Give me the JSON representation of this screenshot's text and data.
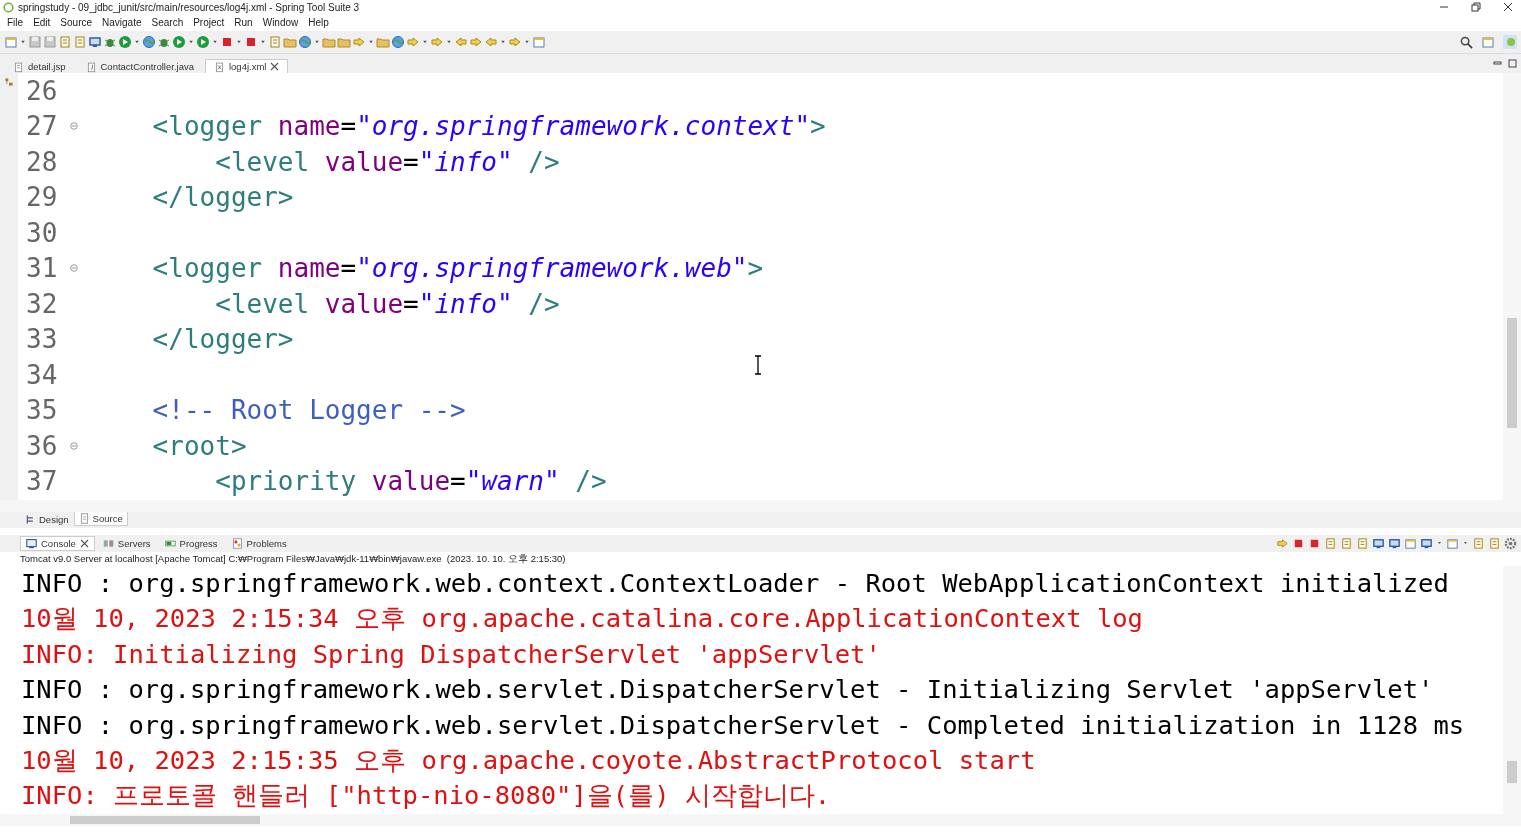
{
  "window": {
    "title": "springstudy - 09_jdbc_junit/src/main/resources/log4j.xml - Spring Tool Suite 3"
  },
  "menu": [
    "File",
    "Edit",
    "Source",
    "Navigate",
    "Search",
    "Project",
    "Run",
    "Window",
    "Help"
  ],
  "editor_tabs": [
    {
      "label": "detail.jsp",
      "kind": "jsp",
      "selected": false
    },
    {
      "label": "ContactController.java",
      "kind": "java",
      "selected": false
    },
    {
      "label": "log4j.xml",
      "kind": "xml",
      "selected": true
    }
  ],
  "code_lines": [
    {
      "number": "26",
      "foldable": false
    },
    {
      "number": "27",
      "foldable": true,
      "tokens": [
        {
          "kind": "tag",
          "text": "    <logger"
        },
        {
          "kind": "attr",
          "text": " name"
        },
        {
          "kind": "punct",
          "text": "="
        },
        {
          "kind": "string",
          "text": "\"org.springframework.context\""
        },
        {
          "kind": "tag",
          "text": ">"
        }
      ]
    },
    {
      "number": "28",
      "foldable": false,
      "tokens": [
        {
          "kind": "tag",
          "text": "        <level"
        },
        {
          "kind": "attr",
          "text": " value"
        },
        {
          "kind": "punct",
          "text": "="
        },
        {
          "kind": "string",
          "text": "\"info\""
        },
        {
          "kind": "tag",
          "text": " />"
        }
      ]
    },
    {
      "number": "29",
      "foldable": false,
      "tokens": [
        {
          "kind": "tag",
          "text": "    </logger>"
        }
      ]
    },
    {
      "number": "30",
      "foldable": false
    },
    {
      "number": "31",
      "foldable": true,
      "tokens": [
        {
          "kind": "tag",
          "text": "    <logger"
        },
        {
          "kind": "attr",
          "text": " name"
        },
        {
          "kind": "punct",
          "text": "="
        },
        {
          "kind": "string",
          "text": "\"org.springframework.web\""
        },
        {
          "kind": "tag",
          "text": ">"
        }
      ]
    },
    {
      "number": "32",
      "foldable": false,
      "tokens": [
        {
          "kind": "tag",
          "text": "        <level"
        },
        {
          "kind": "attr",
          "text": " value"
        },
        {
          "kind": "punct",
          "text": "="
        },
        {
          "kind": "string",
          "text": "\"info\""
        },
        {
          "kind": "tag",
          "text": " />"
        }
      ]
    },
    {
      "number": "33",
      "foldable": false,
      "tokens": [
        {
          "kind": "tag",
          "text": "    </logger>"
        }
      ]
    },
    {
      "number": "34",
      "foldable": false
    },
    {
      "number": "35",
      "foldable": false,
      "tokens": [
        {
          "kind": "comment",
          "text": "    <!-- Root Logger -->"
        }
      ]
    },
    {
      "number": "36",
      "foldable": true,
      "tokens": [
        {
          "kind": "tag",
          "text": "    <root>"
        }
      ]
    },
    {
      "number": "37",
      "foldable": false,
      "tokens": [
        {
          "kind": "tag",
          "text": "        <priority"
        },
        {
          "kind": "attr",
          "text": " value"
        },
        {
          "kind": "punct",
          "text": "="
        },
        {
          "kind": "string",
          "text": "\"warn\""
        },
        {
          "kind": "tag",
          "text": " />"
        }
      ]
    }
  ],
  "editor_mode_tabs": [
    {
      "label": "Design",
      "kind": "design",
      "selected": false
    },
    {
      "label": "Source",
      "kind": "source",
      "selected": true
    }
  ],
  "console_tabs": [
    {
      "label": "Console",
      "kind": "console",
      "selected": true
    },
    {
      "label": "Servers",
      "kind": "servers",
      "selected": false
    },
    {
      "label": "Progress",
      "kind": "progress",
      "selected": false
    },
    {
      "label": "Problems",
      "kind": "problems",
      "selected": false
    }
  ],
  "console": {
    "description": "Tomcat v9.0 Server at localhost [Apache Tomcat] C:₩Program Files₩Java₩jdk-11₩bin₩javaw.exe  (2023. 10. 10. 오후 2:15:30)",
    "lines": [
      {
        "color": "#000000",
        "text": "INFO : org.springframework.web.context.ContextLoader - Root WebApplicationContext initialized"
      },
      {
        "color": "#e01010",
        "text": "10월 10, 2023 2:15:34 오후 org.apache.catalina.core.ApplicationContext log"
      },
      {
        "color": "#e01010",
        "text": "INFO: Initializing Spring DispatcherServlet 'appServlet'"
      },
      {
        "color": "#000000",
        "text": "INFO : org.springframework.web.servlet.DispatcherServlet - Initializing Servlet 'appServlet'"
      },
      {
        "color": "#000000",
        "text": "INFO : org.springframework.web.servlet.DispatcherServlet - Completed initialization in 1128 ms"
      },
      {
        "color": "#e01010",
        "text": "10월 10, 2023 2:15:35 오후 org.apache.coyote.AbstractProtocol start"
      },
      {
        "color": "#e01010",
        "text": "INFO: 프로토콜 핸들러 [\"http-nio-8080\"]을(를) 시작합니다."
      }
    ]
  }
}
